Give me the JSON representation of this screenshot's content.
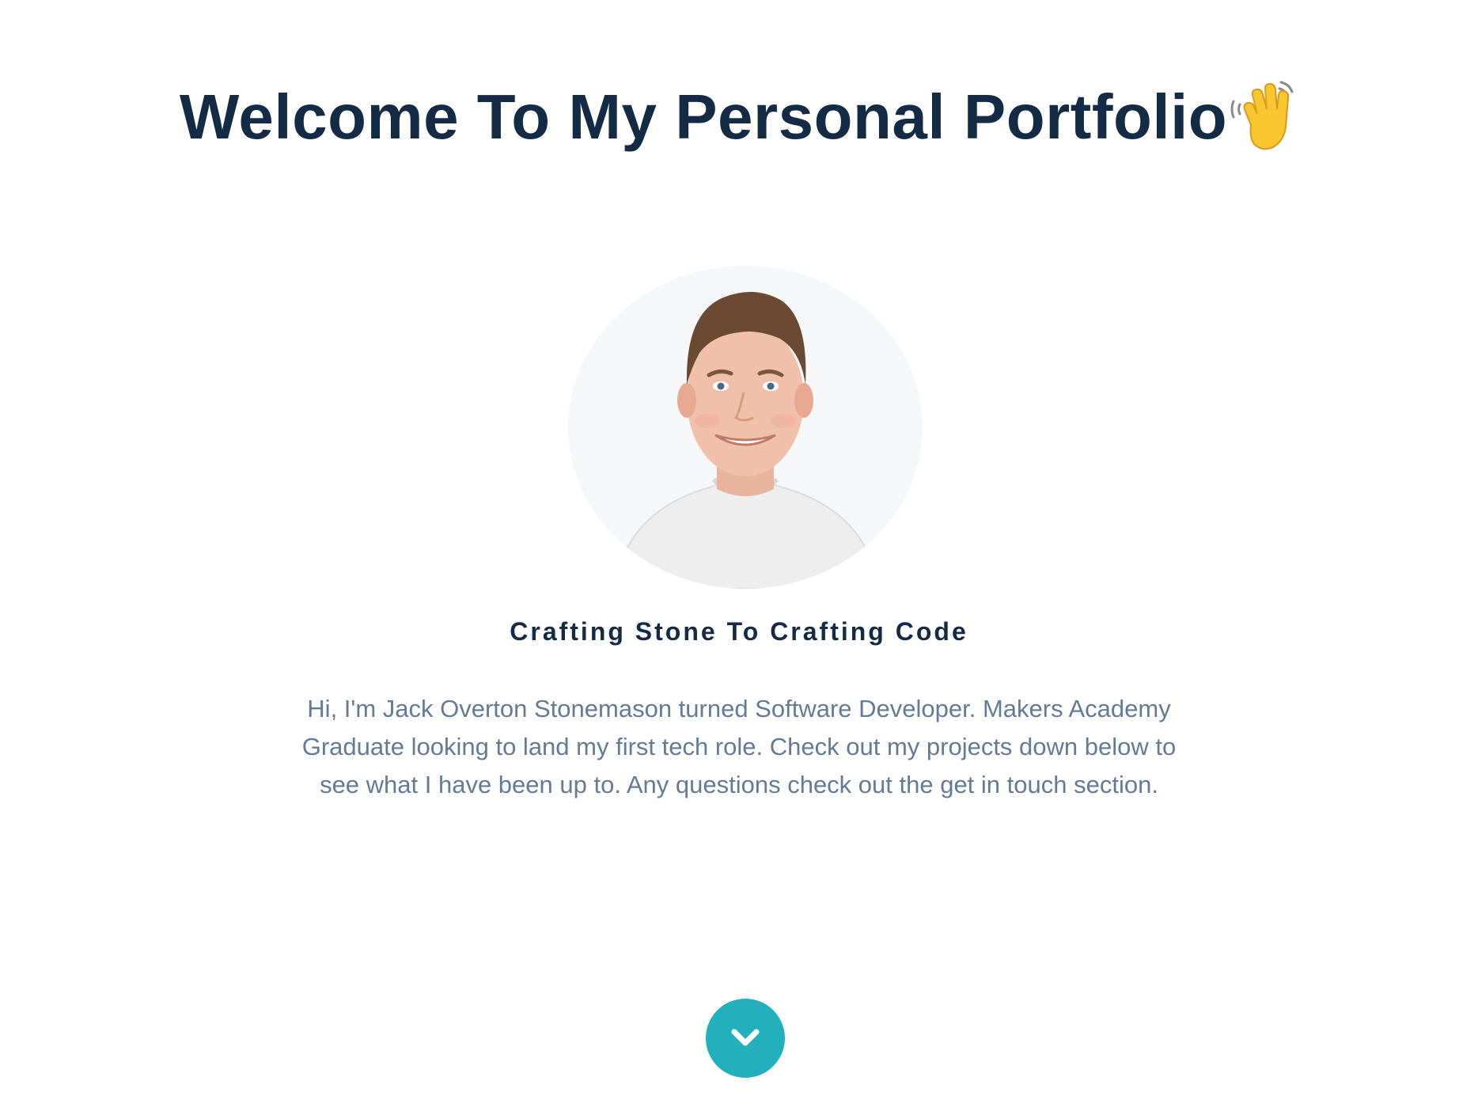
{
  "hero": {
    "title": "Welcome To My Personal Portfolio",
    "title_emoji_icon": "waving-hand-icon",
    "avatar_icon": "profile-photo",
    "tagline": "Crafting Stone To Crafting Code",
    "intro": "Hi, I'm Jack Overton Stonemason turned Software Developer. Makers Academy Graduate looking to land my first tech role. Check out my projects down below to see what I have been up to. Any questions check out the get in touch section.",
    "scroll_button_icon": "chevron-down-icon"
  },
  "colors": {
    "heading": "#132b45",
    "body_text": "#627c98",
    "accent": "#22b0bd",
    "background": "#ffffff"
  }
}
